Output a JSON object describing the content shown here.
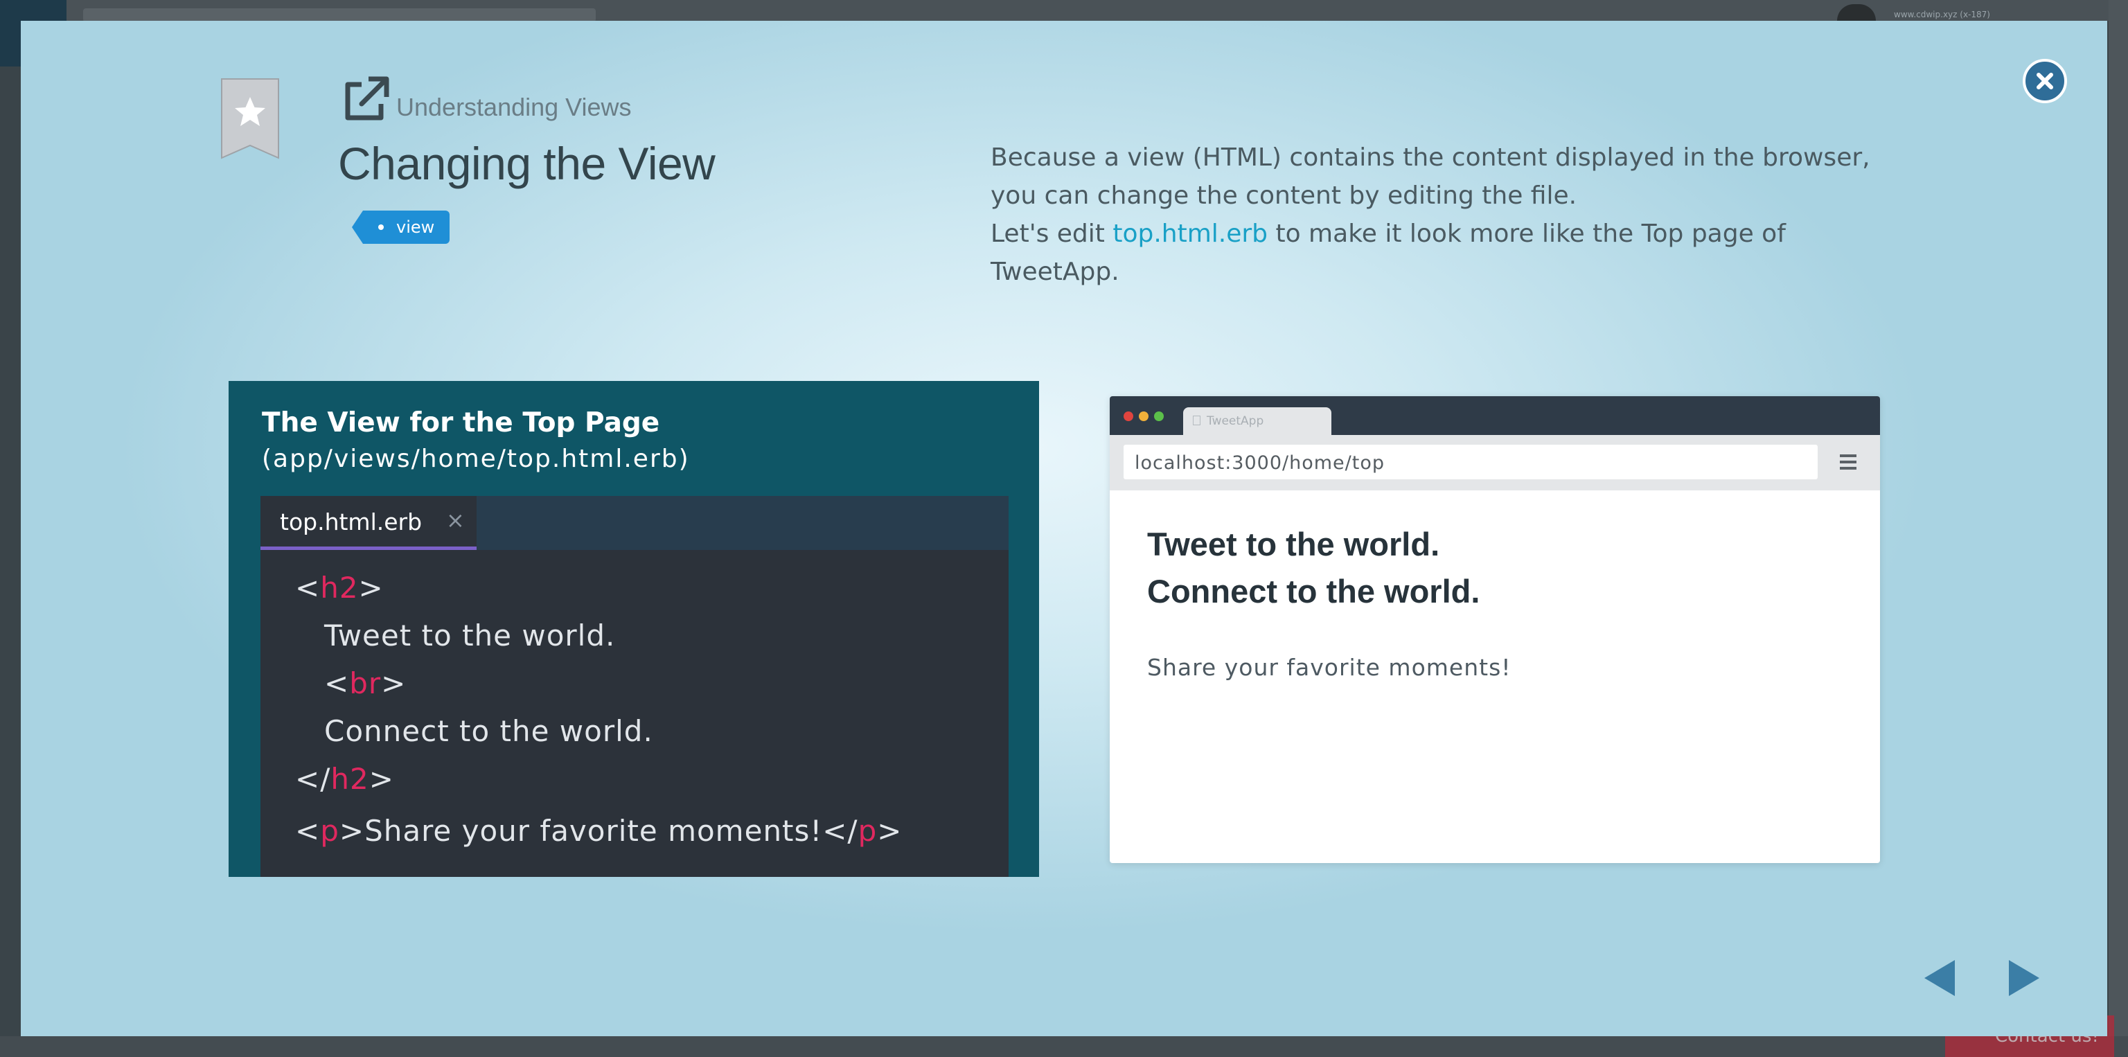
{
  "background": {
    "url_text": "www.cdwip.xyz (x-187)",
    "contact_label": "Contact us!"
  },
  "lesson": {
    "section": "Understanding Views",
    "title": "Changing the View",
    "tag": "view",
    "description_line1": "Because a view (HTML) contains the content displayed in the browser, you can change the content by editing the file.",
    "description_line2_before": "Let's edit ",
    "description_link": "top.html.erb",
    "description_line2_after": " to make it look more like the Top page of TweetApp."
  },
  "code_panel": {
    "title": "The View for the Top Page",
    "path": "(app/views/home/top.html.erb)",
    "tab_name": "top.html.erb",
    "tab_close": "×",
    "lines": {
      "l1_open": "<",
      "l1_tag": "h2",
      "l1_close": ">",
      "l2_text": "Tweet to the world.",
      "l3_open": "<",
      "l3_tag": "br",
      "l3_close": ">",
      "l4_text": "Connect to the world.",
      "l5_open": "</",
      "l5_tag": "h2",
      "l5_close": ">",
      "l6_open": "<",
      "l6_tag": "p",
      "l6_mid": ">Share your favorite moments!</",
      "l6_tag2": "p",
      "l6_close": ">"
    }
  },
  "browser_preview": {
    "tab_title": "TweetApp",
    "url": "localhost:3000/home/top",
    "heading_line1": "Tweet to the world.",
    "heading_line2": "Connect to the world.",
    "paragraph": "Share your favorite moments!"
  },
  "colors": {
    "tag_bg": "#1f8fd6",
    "link": "#19a0c6",
    "code_tag": "#e0285f",
    "panel_bg": "#0f5666",
    "close_button": "#2f6d98"
  },
  "icons": {
    "close": "close-icon",
    "bookmark": "bookmark-ribbon-icon",
    "external": "external-link-icon",
    "prev": "prev-arrow-icon",
    "next": "next-arrow-icon"
  }
}
